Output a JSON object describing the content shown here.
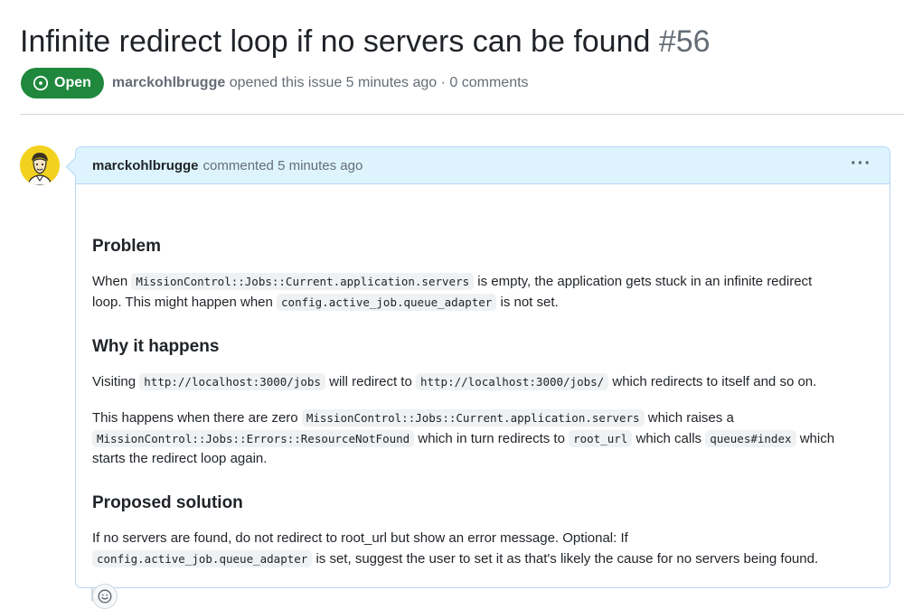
{
  "issue": {
    "title": "Infinite redirect loop if no servers can be found",
    "number": "#56",
    "state": "Open",
    "author": "marckohlbrugge",
    "opened_text": "opened this issue 5 minutes ago · 0 comments"
  },
  "comment": {
    "author": "marckohlbrugge",
    "action_text": "commented 5 minutes ago",
    "menu_icon": "kebab-horizontal-icon",
    "sections": {
      "problem": {
        "heading": "Problem",
        "p1": [
          "When",
          "MissionControl::Jobs::Current.application.servers",
          "is empty, the application gets stuck in an infinite redirect",
          "loop. This might happen when",
          "config.active_job.queue_adapter",
          "is not set."
        ]
      },
      "why": {
        "heading": "Why it happens",
        "p1": [
          "Visiting",
          "http://localhost:3000/jobs",
          "will redirect to",
          "http://localhost:3000/jobs/",
          "which redirects to itself and so on."
        ],
        "p2": [
          "This happens when there are zero",
          "MissionControl::Jobs::Current.application.servers",
          "which raises a",
          "MissionControl::Jobs::Errors::ResourceNotFound",
          "which in turn redirects to",
          "root_url",
          "which calls",
          "queues#index",
          "which",
          "starts the redirect loop again."
        ]
      },
      "solution": {
        "heading": "Proposed solution",
        "p1": [
          "If no servers are found, do not redirect to root_url but show an error message. Optional: If",
          "config.active_job.queue_adapter",
          "is set, suggest the user to set it as that's likely the cause for no servers being found."
        ]
      }
    },
    "reaction_icon": "smiley-icon"
  },
  "colors": {
    "open_badge": "#1f883d",
    "header_bg": "#ddf4ff",
    "header_border": "#b6d7f5",
    "muted_text": "#656d76",
    "avatar_bg": "#f3d21f"
  }
}
